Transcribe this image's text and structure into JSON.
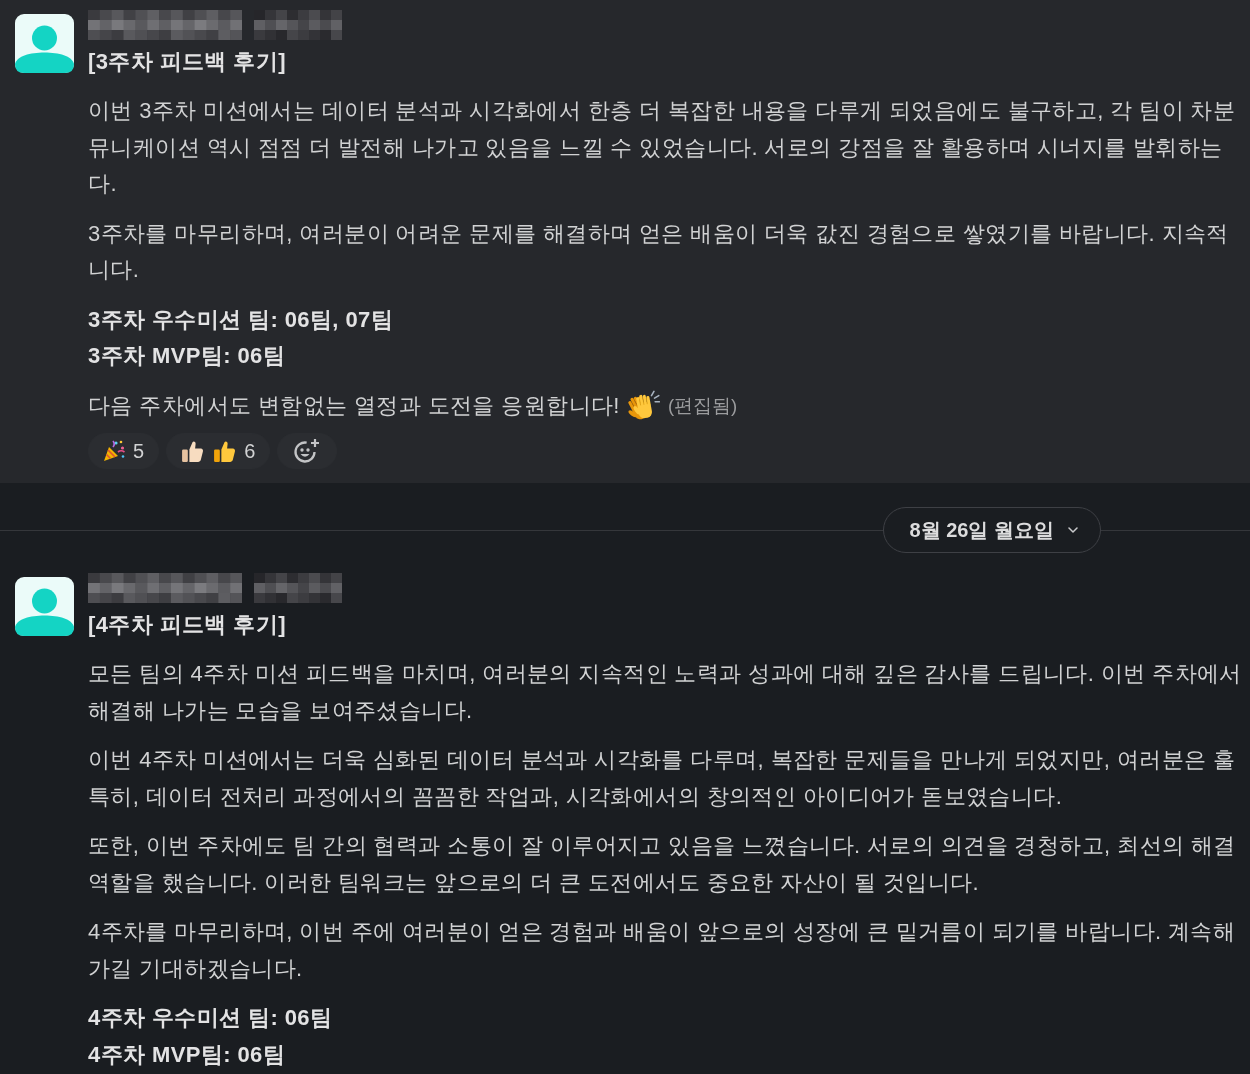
{
  "feed": [
    {
      "kind": "message",
      "highlighted": true,
      "title": "[3주차 피드백 후기]",
      "paragraphs": [
        {
          "kind": "plain",
          "lines": [
            "이번 3주차 미션에서는 데이터 분석과 시각화에서 한층 더 복잡한 내용을 다루게 되었음에도 불구하고, 각 팀이 차분",
            "뮤니케이션 역시 점점 더 발전해 나가고 있음을 느낄 수 있었습니다. 서로의 강점을 잘 활용하며 시너지를 발휘하는",
            "다."
          ]
        },
        {
          "kind": "plain",
          "lines": [
            "3주차를 마무리하며, 여러분이 어려운 문제를 해결하며 얻은 배움이 더욱 값진 경험으로 쌓였기를 바랍니다. 지속적",
            "니다."
          ]
        },
        {
          "kind": "bold",
          "lines": [
            "3주차 우수미션 팀: 06팀, 07팀",
            "3주차 MVP팀: 06팀"
          ]
        },
        {
          "kind": "closing",
          "parts": [
            {
              "kind": "text",
              "text": "다음 주차에서도 변함없는 열정과 도전을 응원합니다!"
            },
            {
              "kind": "clap"
            },
            {
              "kind": "edited",
              "text": "(편집됨)"
            }
          ]
        }
      ],
      "reactions": [
        {
          "kind": "party",
          "count": "5",
          "selected": false
        },
        {
          "kind": "thumbs",
          "count": "6",
          "selected": false
        }
      ]
    },
    {
      "kind": "date_divider",
      "label": "8월 26일 월요일"
    },
    {
      "kind": "message",
      "highlighted": false,
      "title": "[4주차 피드백 후기]",
      "paragraphs": [
        {
          "kind": "plain",
          "lines": [
            "모든 팀의 4주차 미션 피드백을 마치며, 여러분의 지속적인 노력과 성과에 대해 깊은 감사를 드립니다. 이번 주차에서",
            "해결해 나가는 모습을 보여주셨습니다."
          ]
        },
        {
          "kind": "plain",
          "lines": [
            "이번 4주차 미션에서는 더욱 심화된 데이터 분석과 시각화를 다루며, 복잡한 문제들을 만나게 되었지만, 여러분은 훌",
            "특히, 데이터 전처리 과정에서의 꼼꼼한 작업과, 시각화에서의 창의적인 아이디어가 돋보였습니다."
          ]
        },
        {
          "kind": "plain",
          "lines": [
            "또한, 이번 주차에도 팀 간의 협력과 소통이 잘 이루어지고 있음을 느꼈습니다. 서로의 의견을 경청하고, 최선의 해결",
            "역할을 했습니다. 이러한 팀워크는 앞으로의 더 큰 도전에서도 중요한 자산이 될 것입니다."
          ]
        },
        {
          "kind": "plain",
          "lines": [
            "4주차를 마무리하며, 이번 주에 여러분이 얻은 경험과 배움이 앞으로의 성장에 큰 밑거름이 되기를 바랍니다. 계속해",
            "가길 기대하겠습니다."
          ]
        },
        {
          "kind": "bold",
          "lines": [
            "4주차 우수미션 팀: 06팀",
            "4주차 MVP팀: 06팀"
          ]
        }
      ]
    }
  ]
}
